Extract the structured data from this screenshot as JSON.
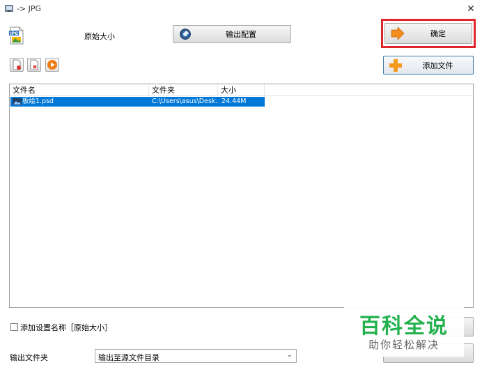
{
  "window": {
    "title": "-> JPG"
  },
  "top": {
    "size_label": "原始大小",
    "output_config_label": "输出配置",
    "ok_label": "确定",
    "add_file_label": "添加文件"
  },
  "file_list": {
    "columns": [
      "文件名",
      "文件夹",
      "大小"
    ],
    "rows": [
      {
        "name": "板绘1.psd",
        "folder": "C:\\Users\\asus\\Desk...",
        "size": "24.44M",
        "selected": true
      }
    ]
  },
  "options": {
    "add_setting_name_label": "添加设置名称［原始大小］",
    "add_setting_name_checked": false
  },
  "output": {
    "folder_label": "输出文件夹",
    "folder_value": "输出至源文件目录"
  },
  "watermark": {
    "title": "百科全说",
    "subtitle": "助你轻松解决"
  },
  "colors": {
    "highlight_frame": "#e0262d",
    "selection": "#0078d7",
    "watermark_green": "#22b14c"
  }
}
